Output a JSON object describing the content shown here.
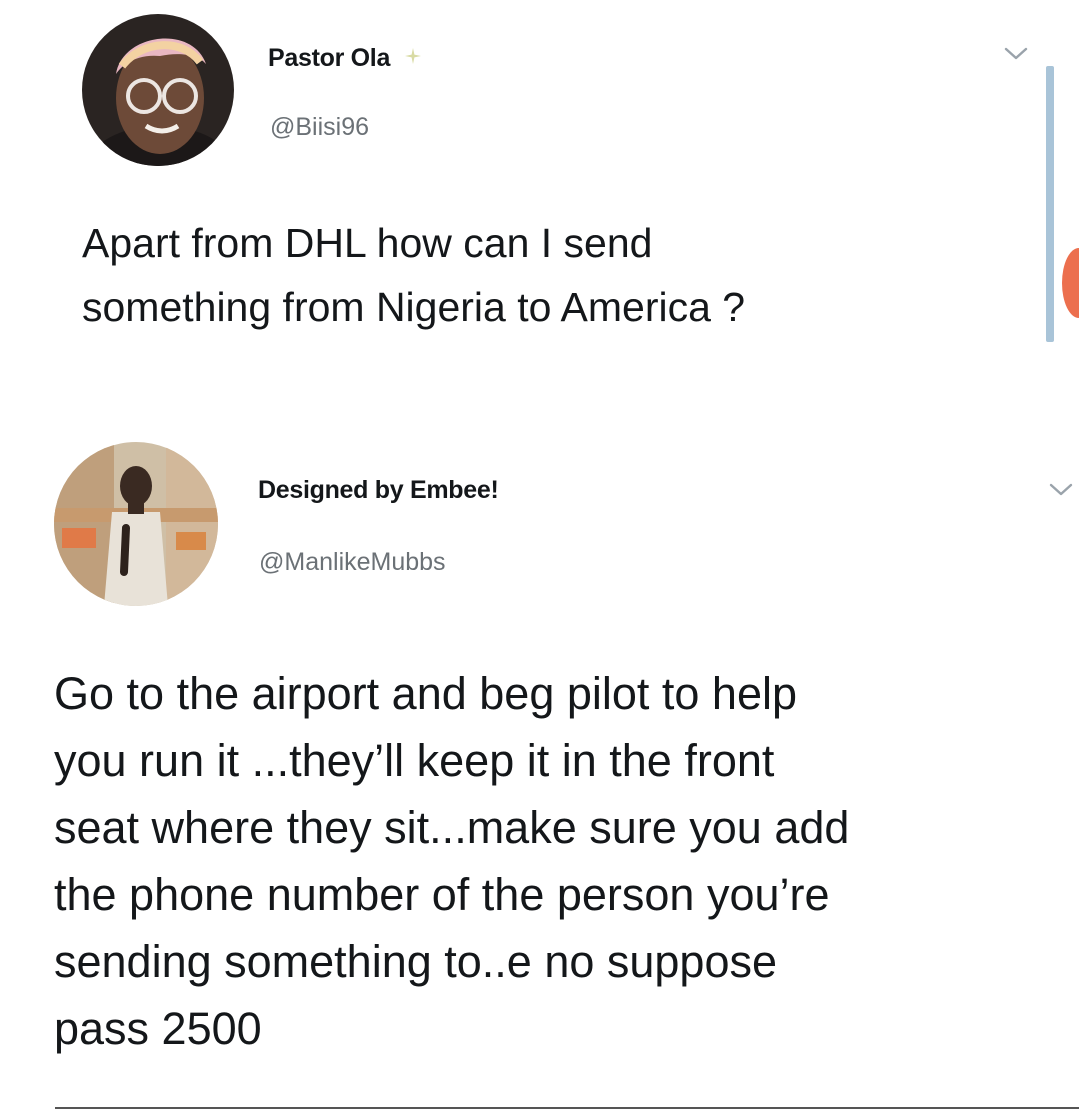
{
  "tweets": [
    {
      "display_name": "Pastor Ola",
      "handle": "@Biisi96",
      "text": "Apart from DHL how can I send\nsomething from Nigeria to America ?"
    },
    {
      "display_name": "Designed by Embee!",
      "handle": "@ManlikeMubbs",
      "text": "Go to the airport and beg pilot to help\nyou run it ...they’ll keep it in the front\nseat where they sit...make sure you add\nthe phone number of the person you’re\nsending something to..e no suppose\npass 2500"
    }
  ],
  "icons": {
    "tweet_menu": "chevron-down-icon",
    "badge": "sparkle-icon"
  },
  "colors": {
    "text": "#14171a",
    "handle": "#6b7176",
    "scroll_track": "#a9c4d8",
    "edge_accent": "#ec6f4e"
  }
}
